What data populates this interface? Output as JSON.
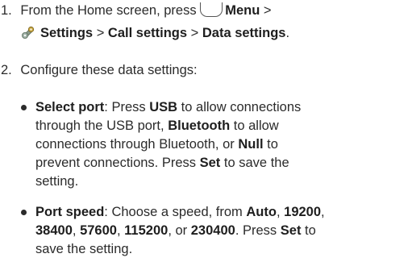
{
  "step1": {
    "number": "1.",
    "pre": "From the Home screen, press",
    "menu": "Menu",
    "sep1": ">",
    "settings": "Settings",
    "sep2": ">",
    "call_settings": "Call settings",
    "sep3": ">",
    "data_settings": "Data settings",
    "end": "."
  },
  "step2": {
    "number": "2.",
    "text": "Configure these data settings:"
  },
  "bullet1": {
    "title": "Select port",
    "colon": ": Press",
    "usb": "USB",
    "l1_rest": "to allow connections",
    "l2_pre": "through the USB port,",
    "bluetooth": "Bluetooth",
    "l2_post": "to allow",
    "l3_pre": "connections through Bluetooth, or",
    "null": "Null",
    "l3_post": "to",
    "l4_pre": "prevent connections. Press",
    "set": "Set",
    "l4_post": "to save the",
    "l5": "setting."
  },
  "bullet2": {
    "title": "Port speed",
    "l1_mid": ": Choose a speed, from",
    "auto": "Auto",
    "comma1": ",",
    "s19200": "19200",
    "comma2": ",",
    "s38400": "38400",
    "comma3": ",",
    "s57600": "57600",
    "comma4": ",",
    "s115200": "115200",
    "comma5": ", or",
    "s230400": "230400",
    "l2_mid": ". Press",
    "set": "Set",
    "l2_post": "to",
    "l3": "save the setting."
  },
  "icons": {
    "menu_key": "menu-key-icon",
    "settings": "settings-gear-icon"
  }
}
